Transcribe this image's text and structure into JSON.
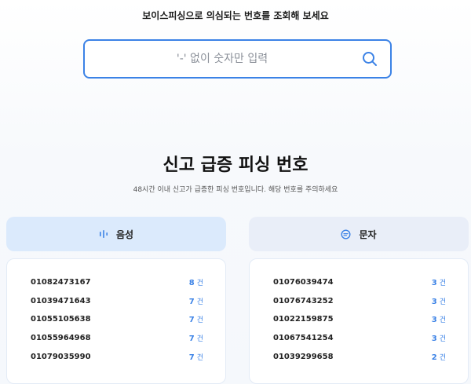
{
  "prompt": "보이스피싱으로 의심되는 번호를 조회해 보세요",
  "search": {
    "placeholder": "'-' 없이 숫자만 입력",
    "icon": "search-icon"
  },
  "section": {
    "title": "신고 급증 피싱 번호",
    "subtitle": "48시간 이내 신고가 급증한 피싱 번호입니다. 해당 번호를 주의하세요"
  },
  "colors": {
    "accent": "#3b82e6"
  },
  "tabs": {
    "voice": {
      "label": "음성",
      "icon": "voice-wave-icon"
    },
    "sms": {
      "label": "문자",
      "icon": "chat-bubble-icon"
    }
  },
  "unit": "건",
  "voice_list": [
    {
      "number": "01082473167",
      "count": "8"
    },
    {
      "number": "01039471643",
      "count": "7"
    },
    {
      "number": "01055105638",
      "count": "7"
    },
    {
      "number": "01055964968",
      "count": "7"
    },
    {
      "number": "01079035990",
      "count": "7"
    }
  ],
  "sms_list": [
    {
      "number": "01076039474",
      "count": "3"
    },
    {
      "number": "01076743252",
      "count": "3"
    },
    {
      "number": "01022159875",
      "count": "3"
    },
    {
      "number": "01067541254",
      "count": "3"
    },
    {
      "number": "01039299658",
      "count": "2"
    }
  ]
}
